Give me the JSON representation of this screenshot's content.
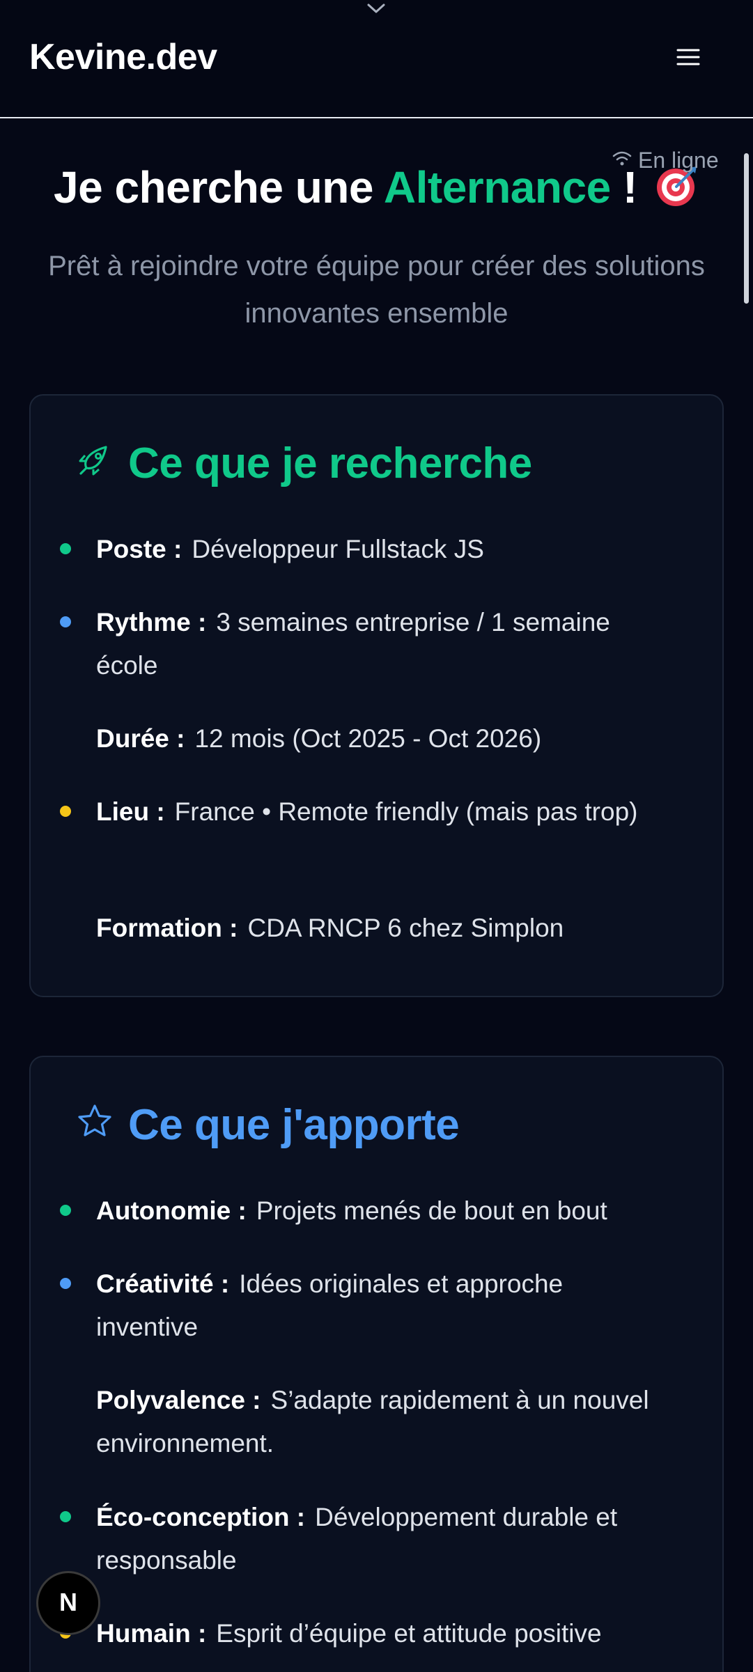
{
  "header": {
    "brand": "Kevine.dev"
  },
  "status": {
    "online_label": "En ligne"
  },
  "hero": {
    "title_prefix": "Je cherche une ",
    "title_accent": "Alternance",
    "title_suffix": " !",
    "subtitle": "Prêt à rejoindre votre équipe pour créer des solutions innovantes ensemble"
  },
  "research_card": {
    "title": "Ce que je recherche",
    "items": [
      {
        "label": "Poste :",
        "value": "Développeur Fullstack JS",
        "bullet": "#10c98a"
      },
      {
        "label": "Rythme :",
        "value": "3 semaines entreprise / 1 semaine école",
        "bullet": "#4f9cf6"
      },
      {
        "label": "Durée :",
        "value": "12 mois (Oct 2025 - Oct 2026)",
        "bullet": ""
      },
      {
        "label": "Lieu :",
        "value": "France • Remote friendly (mais pas trop)",
        "bullet": "#f5c518"
      },
      {
        "label": "Formation :",
        "value": "CDA RNCP 6 chez Simplon",
        "bullet": ""
      }
    ]
  },
  "offer_card": {
    "title": "Ce que j'apporte",
    "items": [
      {
        "label": "Autonomie :",
        "value": "Projets menés de bout en bout",
        "bullet": "#10c98a"
      },
      {
        "label": "Créativité :",
        "value": "Idées originales et approche inventive",
        "bullet": "#4f9cf6"
      },
      {
        "label": "Polyvalence :",
        "value": "S’adapte rapidement à un nouvel environnement.",
        "bullet": ""
      },
      {
        "label": "Éco-conception :",
        "value": "Développement durable et responsable",
        "bullet": "#10c98a"
      },
      {
        "label": "Humain :",
        "value": "Esprit d’équipe et attitude positive",
        "bullet": "#f5c518"
      }
    ]
  },
  "badge": {
    "letter": "N"
  },
  "colors": {
    "accent_green": "#10c98a",
    "accent_blue": "#4f9cf6",
    "accent_yellow": "#f5c518",
    "background": "#050816"
  }
}
